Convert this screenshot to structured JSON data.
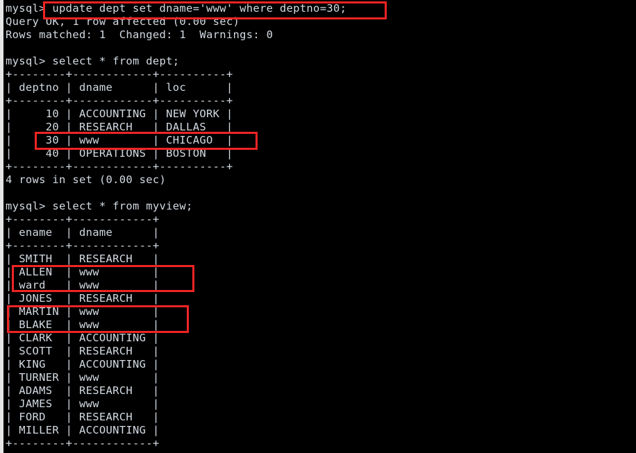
{
  "terminal": {
    "app": "mysql-client-terminal",
    "background_color": "#000000",
    "text_color": "#d3dae2",
    "highlight_color": "#f02424",
    "prompt": "mysql>"
  },
  "lines": [
    {
      "id": "l0",
      "name": "command-update-dept",
      "text": "mysql> update dept set dname='www' where deptno=30;"
    },
    {
      "id": "l1",
      "name": "result-query-ok",
      "text": "Query OK, 1 row affected (0.00 sec)"
    },
    {
      "id": "l2",
      "name": "result-rows-matched",
      "text": "Rows matched: 1  Changed: 1  Warnings: 0"
    },
    {
      "id": "l3",
      "name": "blank-line",
      "text": " "
    },
    {
      "id": "l4",
      "name": "command-select-dept",
      "text": "mysql> select * from dept;"
    },
    {
      "id": "l5",
      "name": "dept-table-border-top",
      "text": "+--------+------------+----------+"
    },
    {
      "id": "l6",
      "name": "dept-table-header",
      "text": "| deptno | dname      | loc      |"
    },
    {
      "id": "l7",
      "name": "dept-table-border-mid",
      "text": "+--------+------------+----------+"
    },
    {
      "id": "l8",
      "name": "dept-row-10",
      "text": "|     10 | ACCOUNTING | NEW YORK |"
    },
    {
      "id": "l9",
      "name": "dept-row-20",
      "text": "|     20 | RESEARCH   | DALLAS   |"
    },
    {
      "id": "l10",
      "name": "dept-row-30",
      "text": "|     30 | www        | CHICAGO  |"
    },
    {
      "id": "l11",
      "name": "dept-row-40",
      "text": "|     40 | OPERATIONS | BOSTON   |"
    },
    {
      "id": "l12",
      "name": "dept-table-border-bottom",
      "text": "+--------+------------+----------+"
    },
    {
      "id": "l13",
      "name": "dept-rows-count",
      "text": "4 rows in set (0.00 sec)"
    },
    {
      "id": "l14",
      "name": "blank-line",
      "text": " "
    },
    {
      "id": "l15",
      "name": "command-select-myview",
      "text": "mysql> select * from myview;"
    },
    {
      "id": "l16",
      "name": "myview-table-border-top",
      "text": "+--------+------------+"
    },
    {
      "id": "l17",
      "name": "myview-table-header",
      "text": "| ename  | dname      |"
    },
    {
      "id": "l18",
      "name": "myview-table-border-mid",
      "text": "+--------+------------+"
    },
    {
      "id": "l19",
      "name": "myview-row-smith",
      "text": "| SMITH  | RESEARCH   |"
    },
    {
      "id": "l20",
      "name": "myview-row-allen",
      "text": "| ALLEN  | www        |"
    },
    {
      "id": "l21",
      "name": "myview-row-ward",
      "text": "| ward   | www        |"
    },
    {
      "id": "l22",
      "name": "myview-row-jones",
      "text": "| JONES  | RESEARCH   |"
    },
    {
      "id": "l23",
      "name": "myview-row-martin",
      "text": "| MARTIN | www        |"
    },
    {
      "id": "l24",
      "name": "myview-row-blake",
      "text": "| BLAKE  | www        |"
    },
    {
      "id": "l25",
      "name": "myview-row-clark",
      "text": "| CLARK  | ACCOUNTING |"
    },
    {
      "id": "l26",
      "name": "myview-row-scott",
      "text": "| SCOTT  | RESEARCH   |"
    },
    {
      "id": "l27",
      "name": "myview-row-king",
      "text": "| KING   | ACCOUNTING |"
    },
    {
      "id": "l28",
      "name": "myview-row-turner",
      "text": "| TURNER | www        |"
    },
    {
      "id": "l29",
      "name": "myview-row-adams",
      "text": "| ADAMS  | RESEARCH   |"
    },
    {
      "id": "l30",
      "name": "myview-row-james",
      "text": "| JAMES  | www        |"
    },
    {
      "id": "l31",
      "name": "myview-row-ford",
      "text": "| FORD   | RESEARCH   |"
    },
    {
      "id": "l32",
      "name": "myview-row-miller",
      "text": "| MILLER | ACCOUNTING |"
    },
    {
      "id": "l33",
      "name": "myview-table-border-bottom",
      "text": "+--------+------------+"
    }
  ],
  "dept_table": {
    "query": "select * from dept;",
    "columns": [
      "deptno",
      "dname",
      "loc"
    ],
    "rows": [
      [
        "10",
        "ACCOUNTING",
        "NEW YORK"
      ],
      [
        "20",
        "RESEARCH",
        "DALLAS"
      ],
      [
        "30",
        "www",
        "CHICAGO"
      ],
      [
        "40",
        "OPERATIONS",
        "BOSTON"
      ]
    ],
    "footer": "4 rows in set (0.00 sec)"
  },
  "myview_table": {
    "query": "select * from myview;",
    "columns": [
      "ename",
      "dname"
    ],
    "rows": [
      [
        "SMITH",
        "RESEARCH"
      ],
      [
        "ALLEN",
        "www"
      ],
      [
        "ward",
        "www"
      ],
      [
        "JONES",
        "RESEARCH"
      ],
      [
        "MARTIN",
        "www"
      ],
      [
        "BLAKE",
        "www"
      ],
      [
        "CLARK",
        "ACCOUNTING"
      ],
      [
        "SCOTT",
        "RESEARCH"
      ],
      [
        "KING",
        "ACCOUNTING"
      ],
      [
        "TURNER",
        "www"
      ],
      [
        "ADAMS",
        "RESEARCH"
      ],
      [
        "JAMES",
        "www"
      ],
      [
        "FORD",
        "RESEARCH"
      ],
      [
        "MILLER",
        "ACCOUNTING"
      ]
    ]
  },
  "annotations": [
    {
      "id": "hl-update",
      "name": "highlight-update-statement",
      "target": "mysql> update dept set dname='www' where deptno=30;"
    },
    {
      "id": "hl-dept30",
      "name": "highlight-dept-row-30",
      "target": "|     30 | www        | CHICAGO  |"
    },
    {
      "id": "hl-allen-ward",
      "name": "highlight-allen-ward-rows",
      "target": "ALLEN / ward -> www"
    },
    {
      "id": "hl-martin-blake",
      "name": "highlight-martin-blake-rows",
      "target": "MARTIN / BLAKE -> www"
    }
  ]
}
